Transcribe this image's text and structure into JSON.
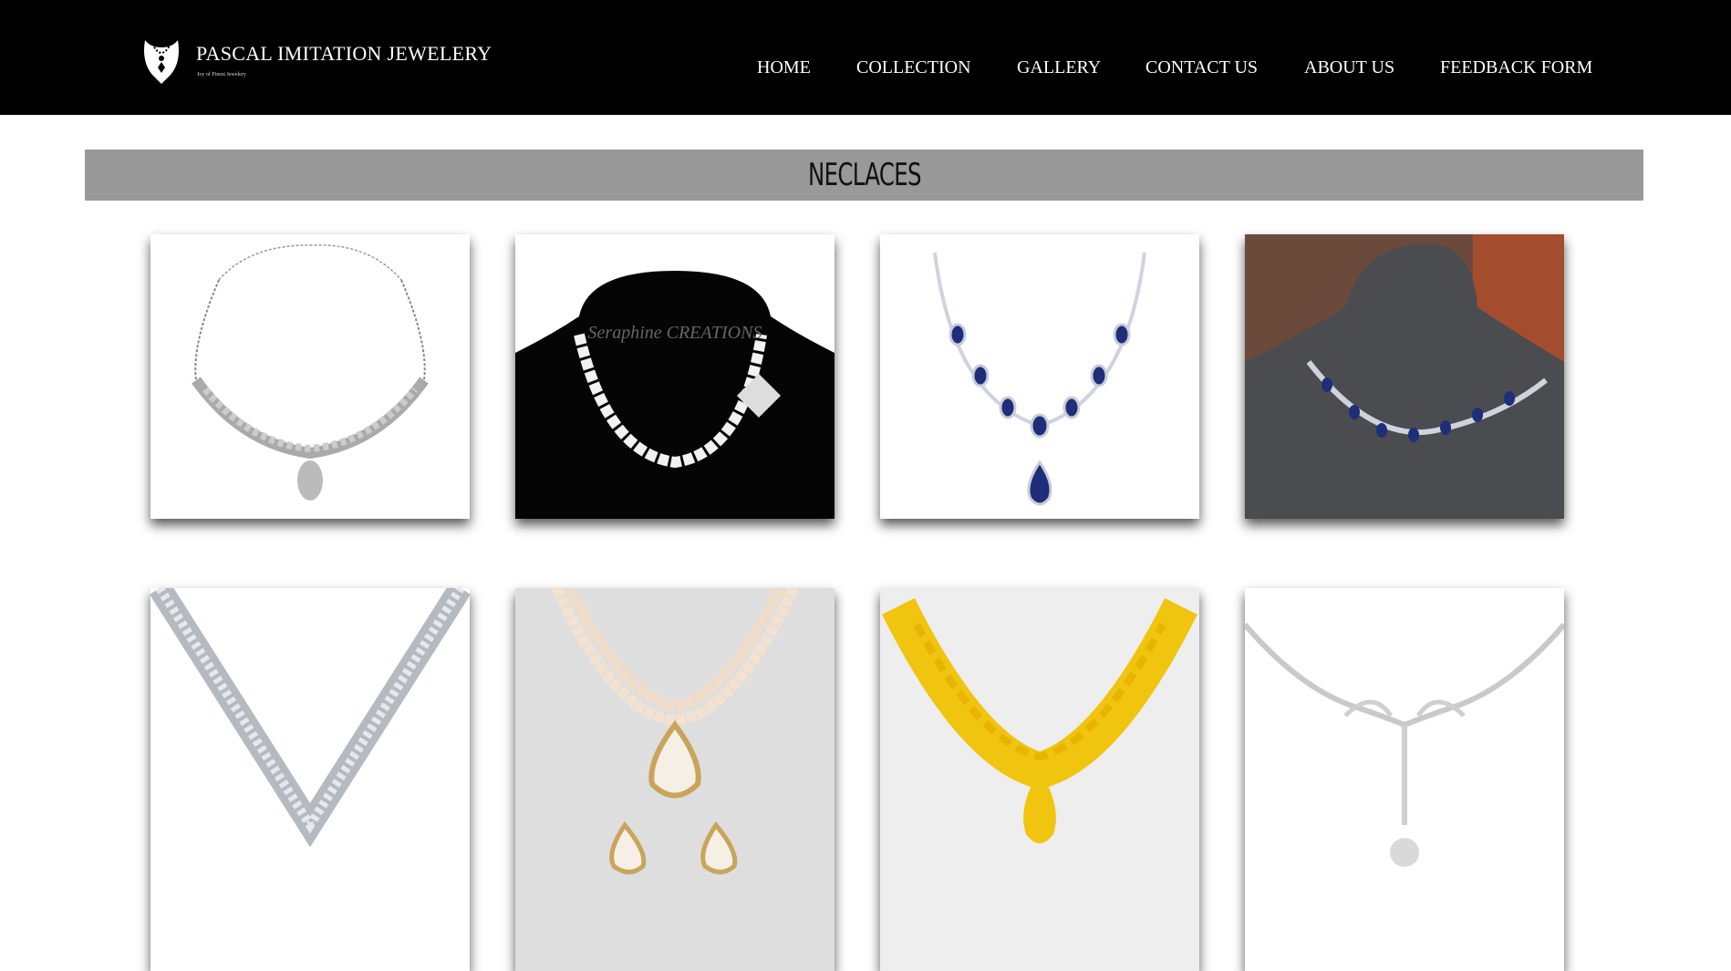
{
  "brand": {
    "name": "PASCAL IMITATION JEWELERY",
    "tagline": "Joy of Finest Jewelery"
  },
  "nav": {
    "items": [
      {
        "label": "HOME"
      },
      {
        "label": "COLLECTION"
      },
      {
        "label": "GALLERY"
      },
      {
        "label": "CONTACT US"
      },
      {
        "label": "ABOUT US"
      },
      {
        "label": "FEEDBACK FORM"
      }
    ]
  },
  "section": {
    "title": "NECLACES"
  },
  "products": [
    {
      "image": "silver-leaf-necklace-image"
    },
    {
      "image": "pearl-necklace-on-bust-image",
      "watermark": "Seraphine CREATIONS"
    },
    {
      "image": "sapphire-drop-necklace-image"
    },
    {
      "image": "sapphire-necklace-on-grey-bust-image"
    },
    {
      "image": "diamond-v-necklace-image"
    },
    {
      "image": "pearl-pendant-and-earrings-image"
    },
    {
      "image": "gold-leaf-necklace-image"
    },
    {
      "image": "diamond-scroll-necklace-image"
    }
  ],
  "colors": {
    "header_bg": "#000000",
    "nav_text": "#ffffff",
    "title_bar": "#999999",
    "page_bg": "#ffffff"
  }
}
